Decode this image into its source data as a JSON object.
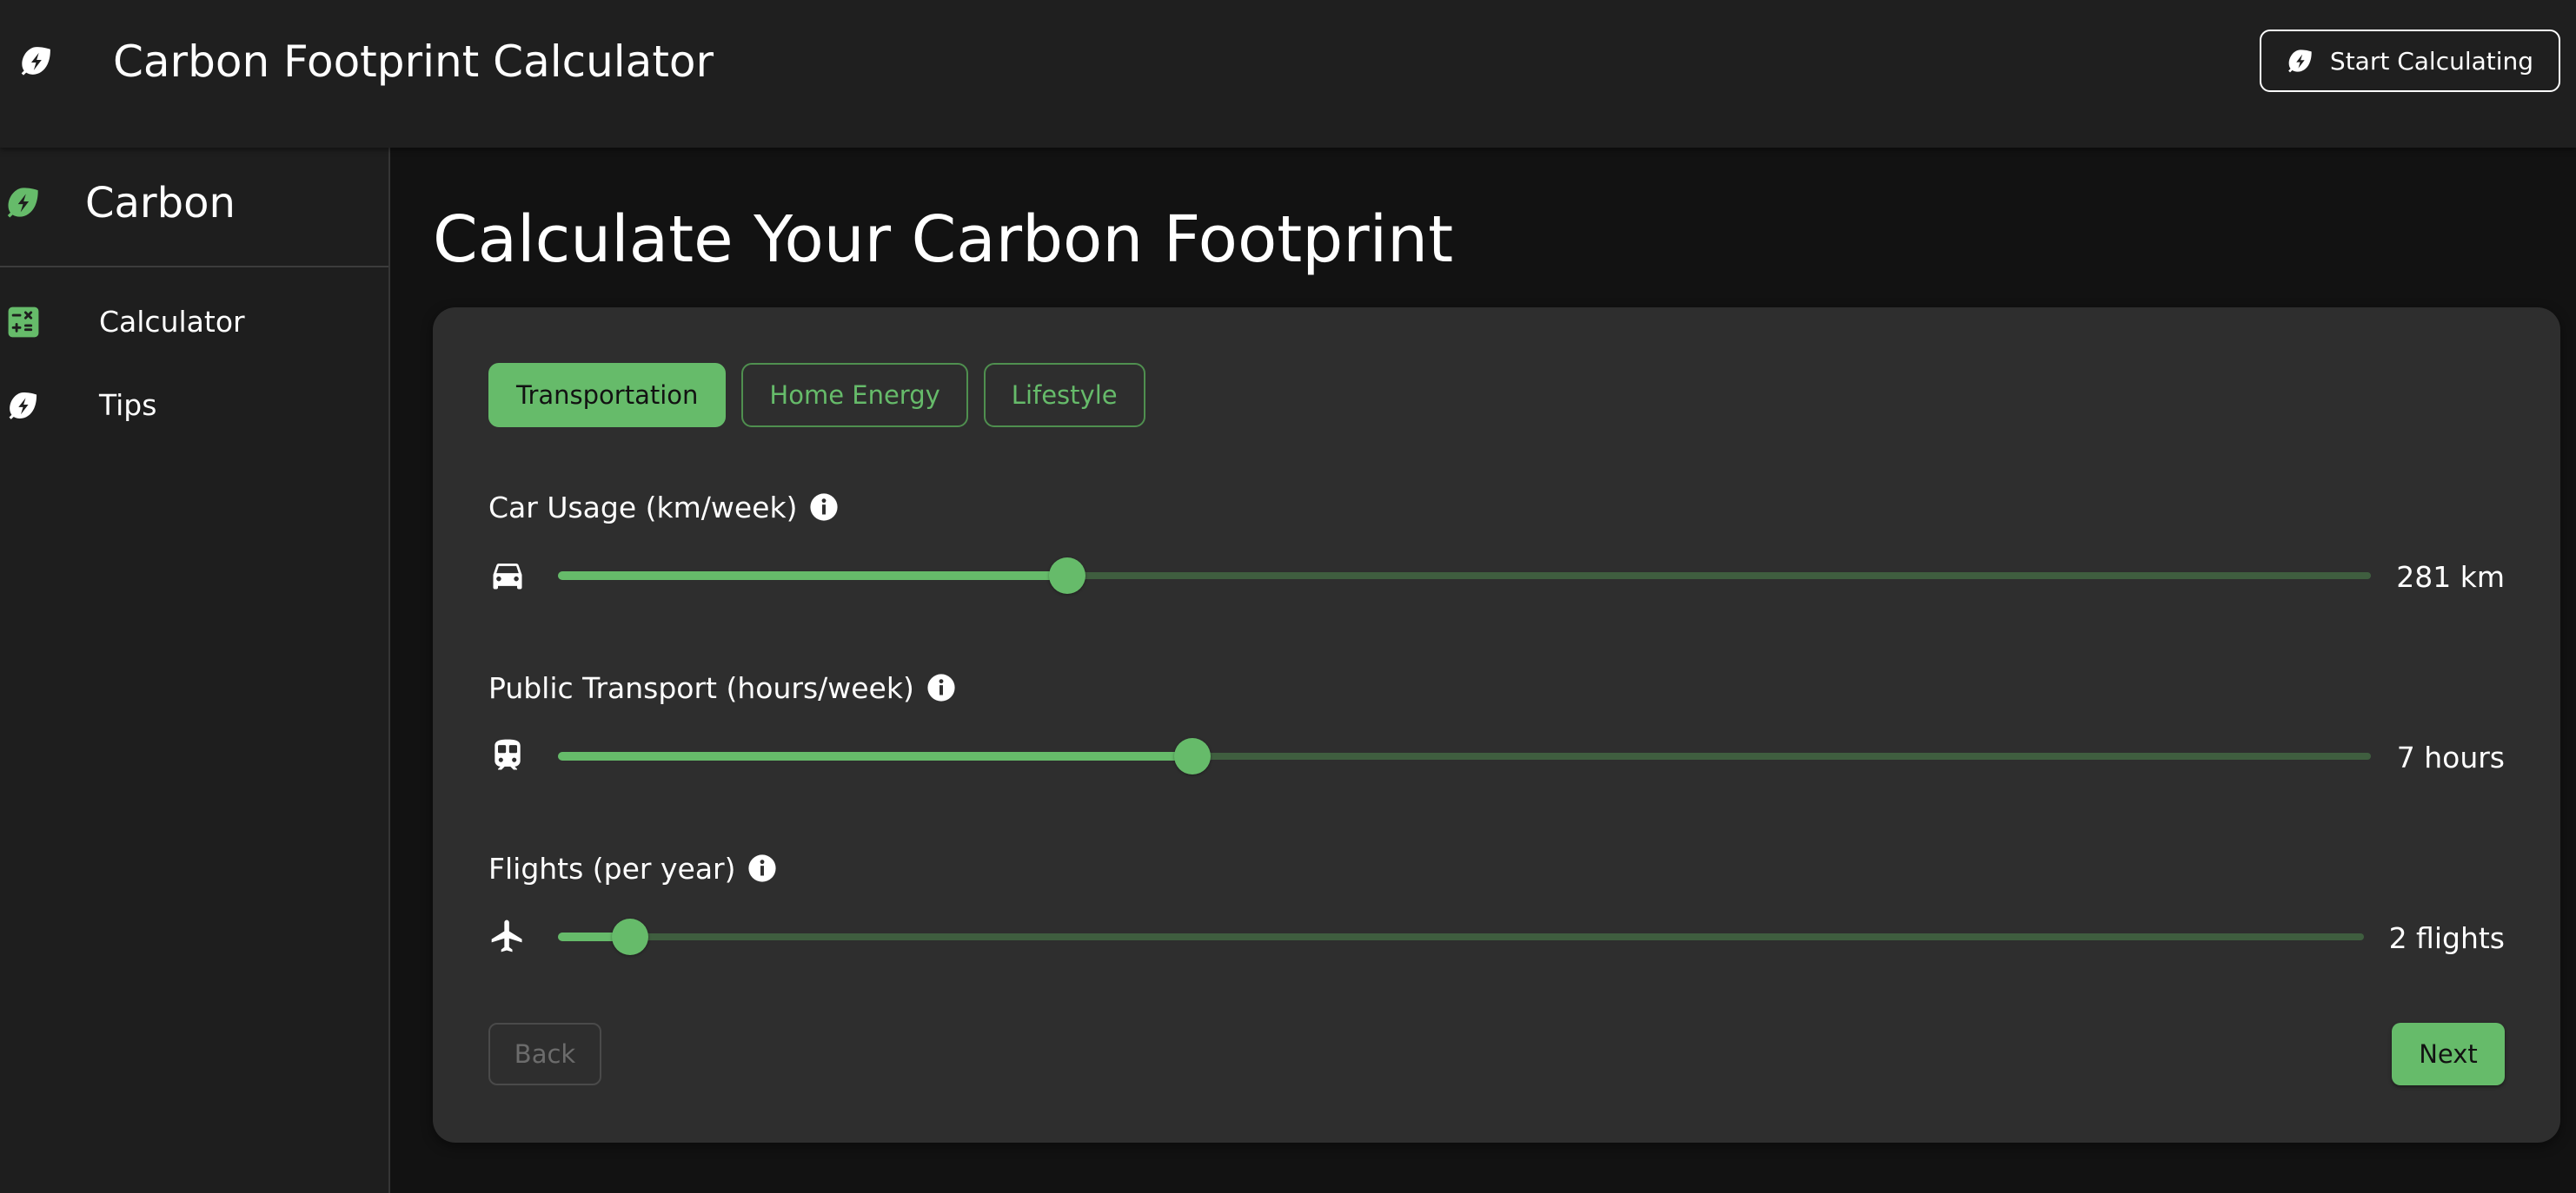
{
  "colors": {
    "accent": "#66bb6a",
    "background": "#121212",
    "surface": "#2e2e2e",
    "appbar": "#1f1f1f",
    "sidebar": "#1e1e1e"
  },
  "appbar": {
    "icon": "eco-bolt-icon",
    "title": "Carbon Footprint Calculator",
    "start_button": {
      "label": "Start Calculating",
      "icon": "eco-bolt-icon"
    }
  },
  "sidebar": {
    "brand": {
      "icon": "eco-bolt-icon",
      "label": "Carbon"
    },
    "items": [
      {
        "label": "Calculator",
        "icon": "calculator-icon"
      },
      {
        "label": "Tips",
        "icon": "eco-bolt-icon"
      }
    ]
  },
  "main": {
    "title": "Calculate Your Carbon Footprint",
    "tabs": [
      {
        "label": "Transportation",
        "active": true
      },
      {
        "label": "Home Energy",
        "active": false
      },
      {
        "label": "Lifestyle",
        "active": false
      }
    ],
    "fields": [
      {
        "label": "Car Usage (km/week)",
        "icon": "car-icon",
        "info_icon": "info-icon",
        "value_text": "281 km",
        "fill_fraction": 0.281
      },
      {
        "label": "Public Transport (hours/week)",
        "icon": "train-icon",
        "info_icon": "info-icon",
        "value_text": "7 hours",
        "fill_fraction": 0.35
      },
      {
        "label": "Flights (per year)",
        "icon": "airplane-icon",
        "info_icon": "info-icon",
        "value_text": "2 flights",
        "fill_fraction": 0.04
      }
    ],
    "back_label": "Back",
    "next_label": "Next"
  }
}
